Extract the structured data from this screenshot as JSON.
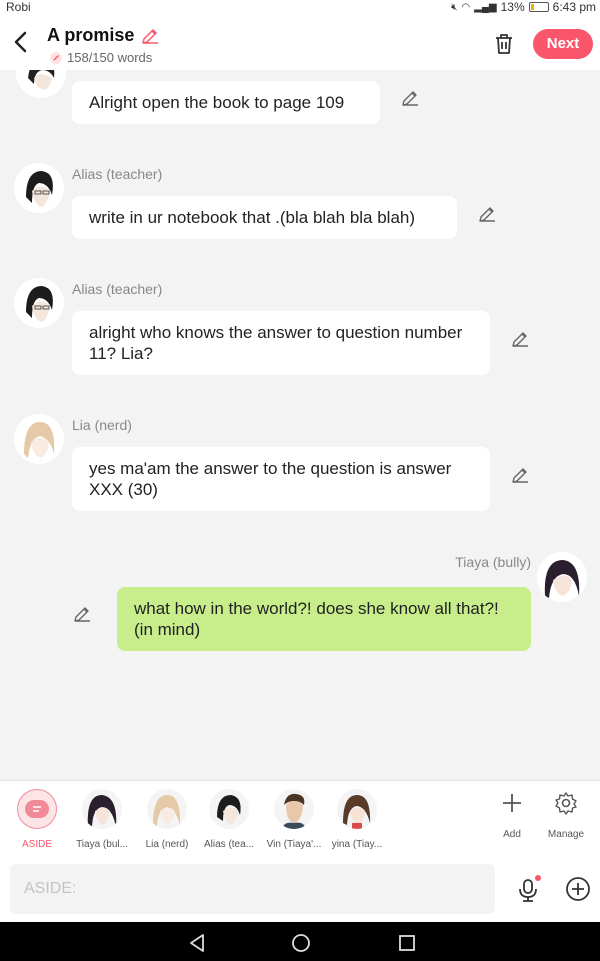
{
  "status": {
    "carrier": "Robi",
    "battery": "13%",
    "time": "6:43 pm"
  },
  "header": {
    "title": "A promise",
    "word_count": "158/150 words",
    "next_label": "Next"
  },
  "messages": [
    {
      "sender": "",
      "text": "Alright open the book to page 109"
    },
    {
      "sender": "Alias (teacher)",
      "text": "write in ur notebook that .(bla blah bla blah)"
    },
    {
      "sender": "Alias (teacher)",
      "text": "alright who knows the answer to question number 11? Lia?"
    },
    {
      "sender": "Lia (nerd)",
      "text": "yes ma'am the answer to the question is answer XXX (30)"
    },
    {
      "sender": "Tiaya (bully)",
      "text": "what how in the world?! does she know all that?! (in mind)"
    }
  ],
  "characters": [
    {
      "label": "ASIDE"
    },
    {
      "label": "Tiaya (bul..."
    },
    {
      "label": "Lia (nerd)"
    },
    {
      "label": "Alias (tea..."
    },
    {
      "label": "Vin (Tiaya'..."
    },
    {
      "label": "yina (Tiay..."
    }
  ],
  "tools": {
    "add_label": "Add",
    "manage_label": "Manage"
  },
  "input": {
    "placeholder": "ASIDE:"
  },
  "colors": {
    "accent": "#f9566b",
    "my_bubble": "#c8ee8c",
    "background": "#f3f3f3"
  }
}
